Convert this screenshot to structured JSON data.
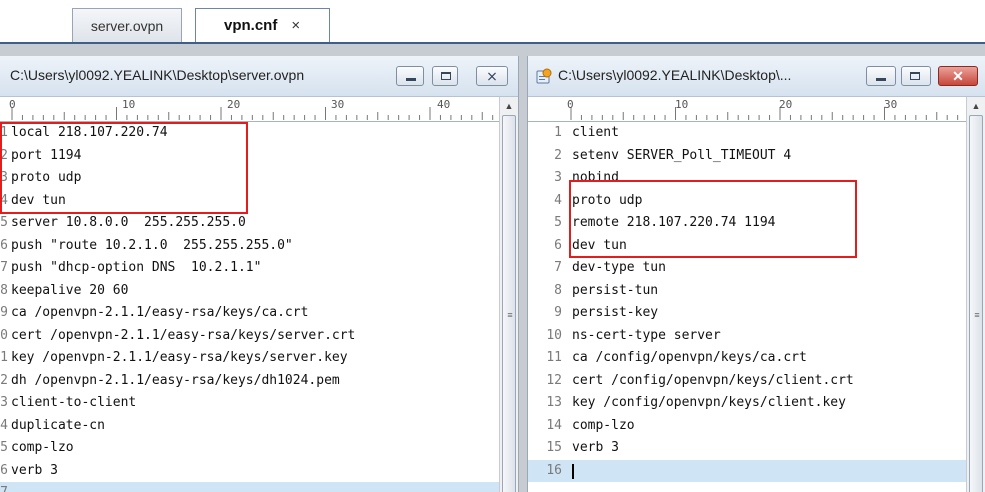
{
  "tabs": [
    {
      "label": "server.ovpn",
      "active": false
    },
    {
      "label": "vpn.cnf",
      "active": true,
      "close": "×"
    }
  ],
  "left_window": {
    "title": "C:\\Users\\yl0092.YEALINK\\Desktop\\server.ovpn",
    "close_glyph": "⨯",
    "ruler": [
      "0",
      "10",
      "20",
      "30",
      "40"
    ],
    "line_numbers": [
      "1",
      "2",
      "3",
      "4",
      "5",
      "6",
      "7",
      "8",
      "9",
      "0",
      "1",
      "2",
      "3",
      "4",
      "5",
      "6",
      "7",
      ""
    ],
    "lines": [
      "local 218.107.220.74",
      "port 1194",
      "proto udp",
      "dev tun",
      "server 10.8.0.0  255.255.255.0",
      "push \"route 10.2.1.0  255.255.255.0\"",
      "push \"dhcp-option DNS  10.2.1.1\"",
      "keepalive 20 60",
      "ca /openvpn-2.1.1/easy-rsa/keys/ca.crt",
      "cert /openvpn-2.1.1/easy-rsa/keys/server.crt",
      "key /openvpn-2.1.1/easy-rsa/keys/server.key",
      "dh /openvpn-2.1.1/easy-rsa/keys/dh1024.pem",
      "client-to-client",
      "duplicate-cn",
      "comp-lzo",
      "verb 3",
      ""
    ]
  },
  "right_window": {
    "title": "C:\\Users\\yl0092.YEALINK\\Desktop\\...",
    "close_glyph": "✕",
    "ruler": [
      "0",
      "10",
      "20",
      "30"
    ],
    "line_numbers": [
      "1",
      "2",
      "3",
      "4",
      "5",
      "6",
      "7",
      "8",
      "9",
      "10",
      "11",
      "12",
      "13",
      "14",
      "15",
      "16"
    ],
    "lines": [
      "client",
      "setenv SERVER_Poll_TIMEOUT 4",
      "nobind",
      "proto udp",
      "remote 218.107.220.74 1194",
      "dev tun",
      "dev-type tun",
      "persist-tun",
      "persist-key",
      "ns-cert-type server",
      "ca /config/openvpn/keys/ca.crt",
      "cert /config/openvpn/keys/client.crt",
      "key /config/openvpn/keys/client.key",
      "comp-lzo",
      "verb 3",
      ""
    ]
  },
  "colors": {
    "highlight_box": "#e51c1c",
    "current_line": "#cfe5f6",
    "tab_underline": "#3f5f88"
  }
}
